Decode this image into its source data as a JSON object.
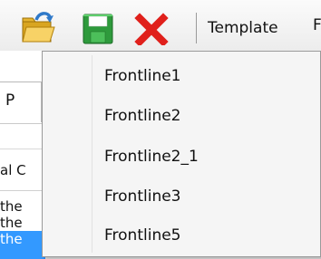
{
  "toolbar": {
    "open_icon": "open-folder-icon",
    "save_icon": "save-disk-icon",
    "delete_icon": "delete-x-icon",
    "template_label": "Template",
    "next_label_partial": "F"
  },
  "background": {
    "tab_label": "P",
    "field_label": "al C",
    "rows": [
      "the",
      "the",
      "the"
    ]
  },
  "menu": {
    "items": [
      "Frontline1",
      "Frontline2",
      "Frontline2_1",
      "Frontline3",
      "Frontline5"
    ]
  },
  "colors": {
    "selection": "#3399ff",
    "delete_red": "#e0201b",
    "save_green": "#2e9a3c",
    "folder_yellow": "#f1c232"
  }
}
